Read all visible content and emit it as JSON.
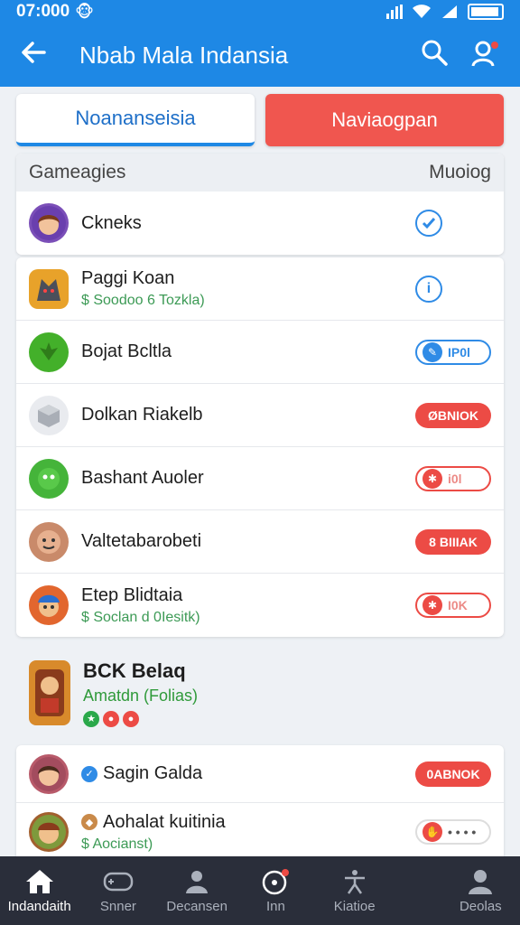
{
  "status": {
    "time": "07:000",
    "emoji": "🐵"
  },
  "header": {
    "back_icon": "arrow-left-icon",
    "title": "Nbab Mala Indansia",
    "search_icon": "search-icon",
    "profile_icon": "user-alert-icon"
  },
  "tabs": [
    {
      "label": "Noananseisia"
    },
    {
      "label": "Naviaogpan"
    }
  ],
  "section_top": {
    "title": "Gameagies",
    "action": "Muoiog",
    "row": {
      "name": "Ckneks",
      "status": "check"
    }
  },
  "list": [
    {
      "name": "Paggi Koan",
      "sub": "$ Soodoo 6 Tozkla)",
      "control": "circle",
      "control_text": "i",
      "icon_color": "#e8a22a"
    },
    {
      "name": "Bojat Bcltla",
      "sub": "",
      "control": "blue-outline",
      "control_text": "IP0l",
      "icon_color": "#43b02a"
    },
    {
      "name": "Dolkan Riakelb",
      "sub": "",
      "control": "red",
      "control_text": "ØBNIOK",
      "icon_color": "#b7bcc4"
    },
    {
      "name": "Bashant Auoler",
      "sub": "",
      "control": "red-outline",
      "control_text": "i0l",
      "icon_color": "#45b43a"
    },
    {
      "name": "Valtetabarobeti",
      "sub": "",
      "control": "red",
      "control_text": "8 BIIIAK",
      "icon_color": "#c98a6a"
    },
    {
      "name": "Etep Blidtaia",
      "sub": "$ Soclan d 0Iesitk)",
      "control": "red-outline",
      "control_text": "I0K",
      "icon_color": "#e2662e"
    }
  ],
  "featured": {
    "name": "BCK Belaq",
    "sub": "Amatdn (Folias)",
    "icon_color": "#d88a2b"
  },
  "section_bottom": [
    {
      "name": "Sagin Galda",
      "sub": "",
      "control": "red",
      "control_text": "0ABNOK",
      "icon_color": "#b85a6a"
    },
    {
      "name": "Aohalat kuitinia",
      "sub": "$ Aocianst)",
      "control": "red-dots",
      "control_text": "• • • •",
      "icon_color": "#a2602e"
    }
  ],
  "bottom_nav": [
    {
      "label": "Indandaith",
      "icon": "home-icon",
      "active": true
    },
    {
      "label": "Snner",
      "icon": "controller-icon",
      "active": false
    },
    {
      "label": "Decansen",
      "icon": "people-icon",
      "active": false
    },
    {
      "label": "Inn",
      "icon": "record-icon",
      "active": false
    },
    {
      "label": "Kiatioe",
      "icon": "accessibility-icon",
      "active": false
    },
    {
      "label": "Deolas",
      "icon": "person-icon",
      "active": false
    }
  ]
}
